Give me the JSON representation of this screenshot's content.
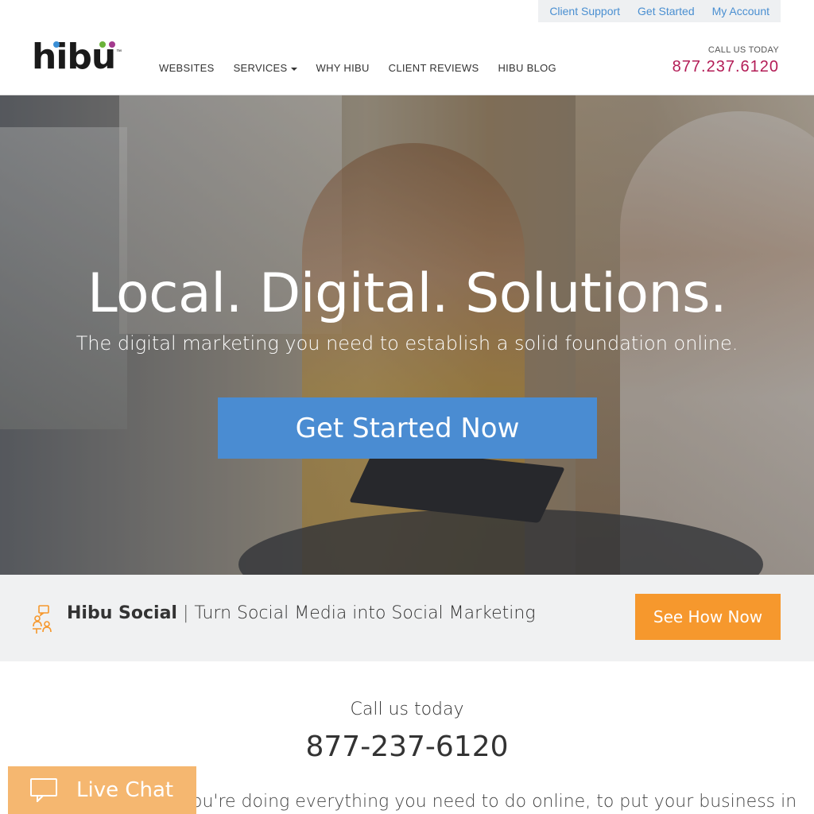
{
  "utility_nav": {
    "client_support": "Client Support",
    "get_started": "Get Started",
    "my_account": "My Account"
  },
  "header": {
    "logo_text": "hibu",
    "logo_tm": "™",
    "nav": [
      "WEBSITES",
      "SERVICES",
      "WHY HIBU",
      "CLIENT REVIEWS",
      "HIBU BLOG"
    ],
    "call_label": "CALL US TODAY",
    "call_phone": "877.237.6120"
  },
  "hero": {
    "title": "Local. Digital. Solutions.",
    "subtitle": "The digital marketing you need to establish a solid foundation online.",
    "cta": "Get Started Now"
  },
  "promo": {
    "title": "Hibu Social",
    "separator": "|",
    "subtitle": "Turn Social Media into Social Marketing",
    "cta": "See How Now"
  },
  "call_section": {
    "label": "Call us today",
    "phone": "877-237-6120",
    "body": "you're doing everything you need to do online, to put your business in"
  },
  "live_chat": {
    "label": "Live Chat"
  },
  "colors": {
    "accent_blue": "#4a8cd2",
    "phone_magenta": "#b31c56",
    "promo_orange": "#f6982d",
    "chat_orange": "#f5b770"
  }
}
